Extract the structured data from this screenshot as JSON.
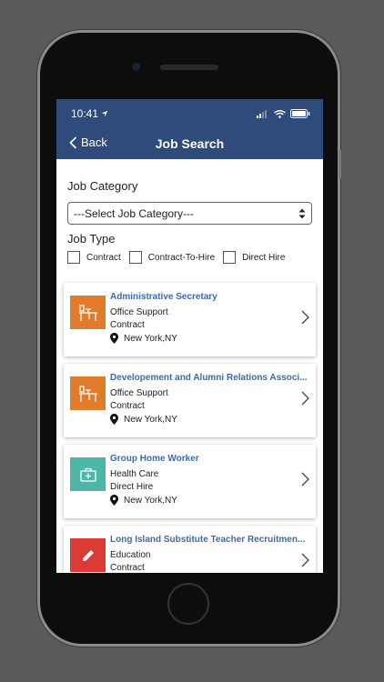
{
  "status": {
    "time": "10:41"
  },
  "nav": {
    "back_label": "Back",
    "title": "Job Search"
  },
  "filters": {
    "category_label": "Job Category",
    "category_select": "---Select Job Category---",
    "type_label": "Job Type",
    "types": [
      "Contract",
      "Contract-To-Hire",
      "Direct Hire"
    ]
  },
  "jobs": [
    {
      "title": "Administrative Secretary",
      "category": "Office Support",
      "type": "Contract",
      "location": "New York,NY",
      "icon": "desk-icon",
      "color": "#e27b2a"
    },
    {
      "title": "Developement and Alumni Relations Associ...",
      "category": "Office Support",
      "type": "Contract",
      "location": "New York,NY",
      "icon": "desk-icon",
      "color": "#e27b2a"
    },
    {
      "title": "Group Home Worker",
      "category": "Health Care",
      "type": "Direct Hire",
      "location": "New York,NY",
      "icon": "medical-kit-icon",
      "color": "#4db6a6"
    },
    {
      "title": "Long Island Substitute Teacher Recruitmen...",
      "category": "Education",
      "type": "Contract",
      "location": "",
      "icon": "pencil-icon",
      "color": "#db3b34"
    }
  ],
  "colors": {
    "header": "#2f4b7c",
    "link": "#3d6aa8"
  }
}
